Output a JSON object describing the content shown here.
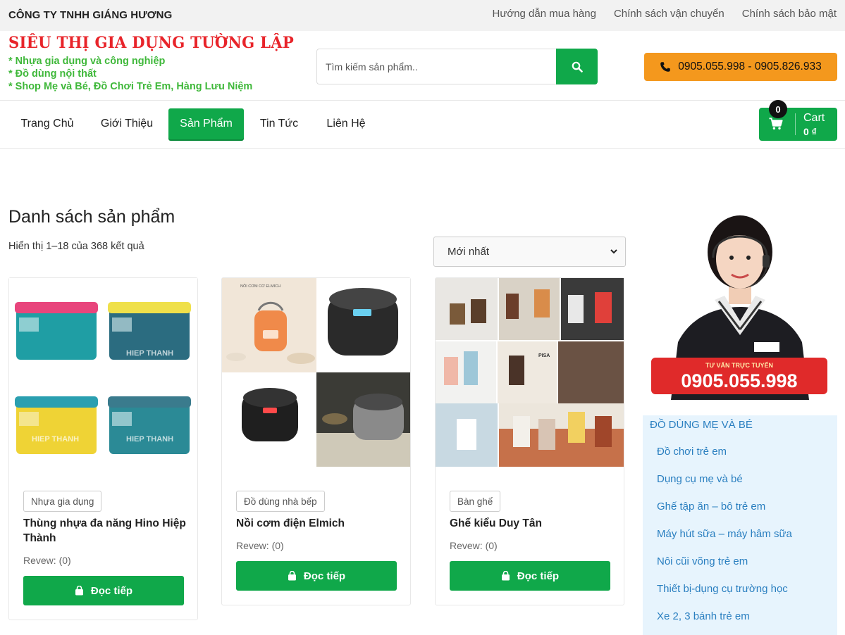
{
  "topbar": {
    "company": "CÔNG TY TNHH GIÁNG HƯƠNG",
    "links": [
      "Hướng dẫn mua hàng",
      "Chính sách vận chuyển",
      "Chính sách bảo mật"
    ]
  },
  "header": {
    "brand": "SIÊU THỊ GIA DỤNG TƯỜNG LẬP",
    "taglines": [
      "* Nhựa gia dụng và công nghiệp",
      "* Đồ dùng nội thất",
      "* Shop Mẹ và Bé, Đồ Chơi Trẻ Em, Hàng Lưu Niệm"
    ],
    "search_placeholder": "Tìm kiếm sản phẩm..",
    "phone": "0905.055.998 - 0905.826.933"
  },
  "nav": {
    "items": [
      "Trang Chủ",
      "Giới Thiệu",
      "Sản Phẩm",
      "Tin Tức",
      "Liên Hệ"
    ],
    "active": "Sản Phẩm",
    "cart_label": "Cart",
    "cart_total": "0 ₫",
    "cart_count": "0"
  },
  "listing": {
    "title": "Danh sách sản phẩm",
    "result_count": "Hiển thị 1–18 của 368 kết quả",
    "sort_selected": "Mới nhất"
  },
  "products": [
    {
      "category": "Nhựa gia dụng",
      "name": "Thùng nhựa đa năng Hino Hiệp Thành",
      "review": "Revew: (0)",
      "button": "Đọc tiếp",
      "image_text": "HIEP THANH"
    },
    {
      "category": "Đồ dùng nhà bếp",
      "name": "Nồi cơm điện Elmich",
      "review": "Revew: (0)",
      "button": "Đọc tiếp",
      "image_text": "NỒI CƠM CƠ ELMICH"
    },
    {
      "category": "Bàn ghế",
      "name": "Ghế kiểu Duy Tân",
      "review": "Revew: (0)",
      "button": "Đọc tiếp",
      "image_text": "PISA"
    }
  ],
  "sidebar": {
    "hotline_caption": "TƯ VẤN TRỰC TUYẾN",
    "hotline": "0905.055.998",
    "heading": "ĐỒ DÙNG MẸ VÀ BÉ",
    "items": [
      "Đồ chơi trẻ em",
      "Dụng cụ mẹ và bé",
      "Ghế tập ăn – bô trẻ em",
      "Máy hút sữa – máy hâm sữa",
      "Nôi cũi võng trẻ em",
      "Thiết bị-dụng cụ trường học",
      "Xe 2, 3 bánh trẻ em"
    ]
  },
  "colors": {
    "green": "#10a84a",
    "orange": "#f4981d",
    "red": "#e8242a",
    "light_blue_bg": "#e7f4fd",
    "link_blue": "#2a7fc0"
  }
}
